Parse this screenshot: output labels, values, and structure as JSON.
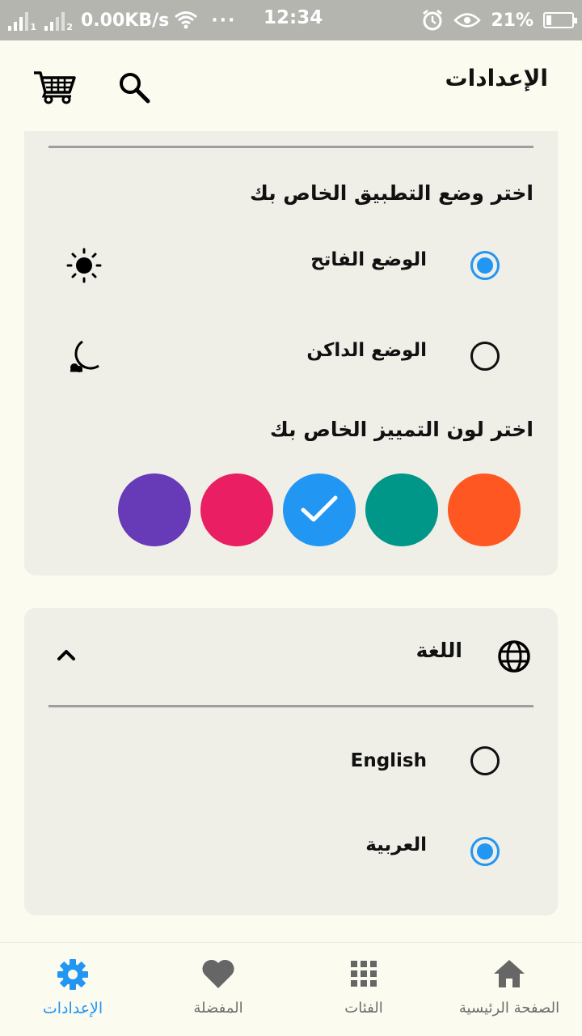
{
  "status_bar": {
    "sim1": "1",
    "sim2": "2",
    "network_speed": "0.00KB/s",
    "more": "···",
    "time": "12:34",
    "battery": "21%"
  },
  "app_bar": {
    "title": "الإعدادات",
    "icons": [
      "cart-icon",
      "search-icon"
    ]
  },
  "theme_section": {
    "mode_title": "اختر وضع التطبيق الخاص بك",
    "modes": [
      {
        "label": "الوضع الفاتح",
        "icon": "sun-icon",
        "selected": true
      },
      {
        "label": "الوضع الداكن",
        "icon": "moon-icon",
        "selected": false
      }
    ],
    "accent_title": "اختر لون التمييز الخاص بك",
    "accent_colors": [
      {
        "color": "#673ab7",
        "selected": false
      },
      {
        "color": "#e91e63",
        "selected": false
      },
      {
        "color": "#2196f3",
        "selected": true
      },
      {
        "color": "#009688",
        "selected": false
      },
      {
        "color": "#ff5722",
        "selected": false
      }
    ]
  },
  "language_section": {
    "title": "اللغة",
    "icon": "globe-icon",
    "expanded": true,
    "options": [
      {
        "label": "English",
        "selected": false
      },
      {
        "label": "العربية",
        "selected": true
      }
    ]
  },
  "bottom_nav": {
    "active_color": "#2196f3",
    "items": [
      {
        "label": "الصفحة الرئيسية",
        "icon": "home-icon",
        "active": false
      },
      {
        "label": "الفئات",
        "icon": "grid-icon",
        "active": false
      },
      {
        "label": "المفضلة",
        "icon": "heart-icon",
        "active": false
      },
      {
        "label": "الإعدادات",
        "icon": "gear-icon",
        "active": true
      }
    ]
  }
}
